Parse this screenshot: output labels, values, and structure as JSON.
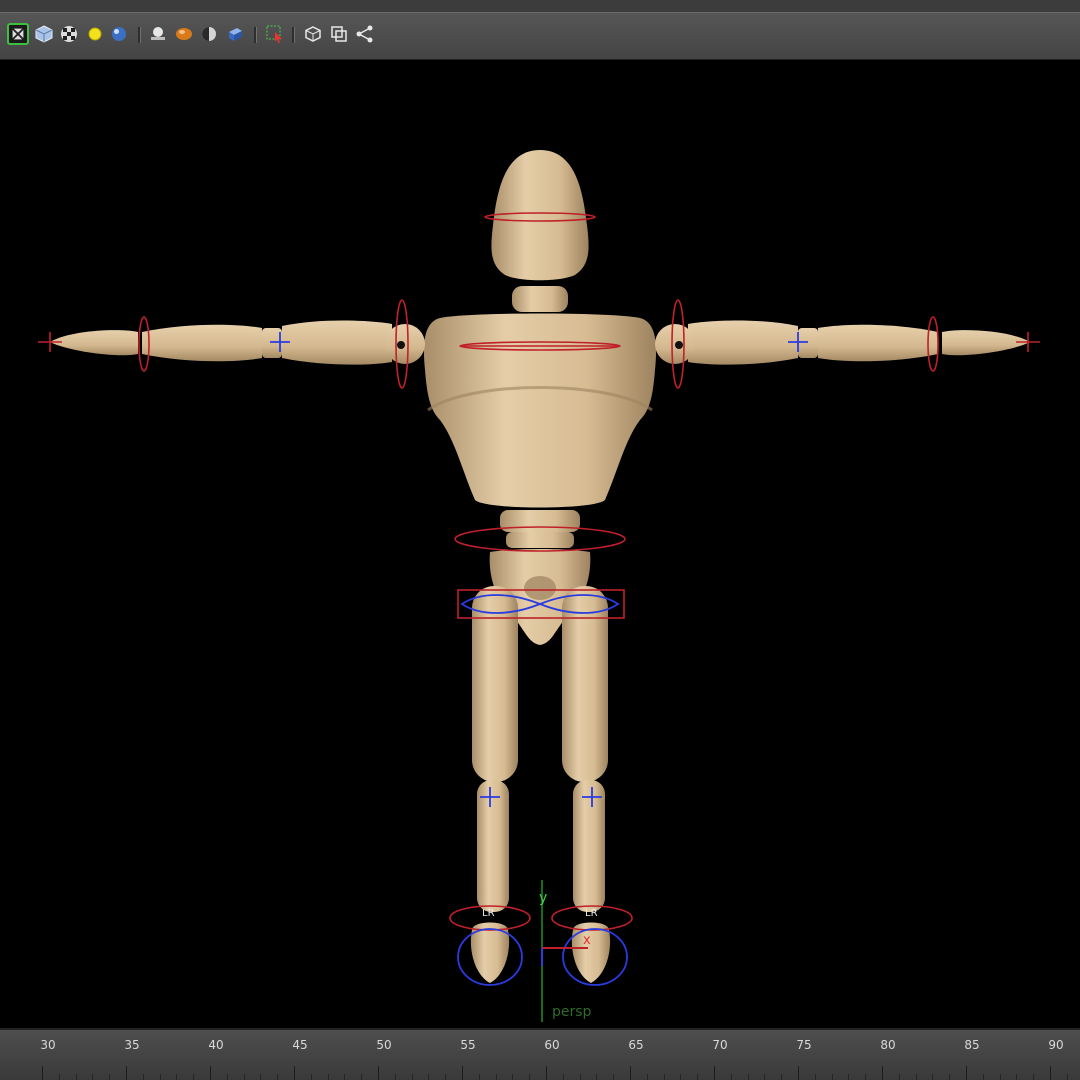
{
  "toolbar": {
    "icons": [
      "isolate-select-icon",
      "wireframe-cube-icon",
      "checker-texture-icon",
      "light-bulb-icon",
      "shaded-sphere-icon",
      "xray-joint-icon",
      "shadow-ball-icon",
      "half-sphere-icon",
      "blue-cube-icon",
      "select-camera-icon",
      "bounding-box-icon",
      "frame-all-icon",
      "share-graph-icon"
    ]
  },
  "viewport": {
    "camera_label": "persp",
    "axis_y_label": "y",
    "axis_x_label": "x",
    "foot_left_label": "LR",
    "foot_right_label": "LR",
    "background_color": "#000000",
    "skin_color": "#d9bf99",
    "control_color": "#c0202a",
    "joint_color": "#2a3be0"
  },
  "timeline": {
    "ticks": [
      "30",
      "35",
      "40",
      "45",
      "50",
      "55",
      "60",
      "65",
      "70",
      "75",
      "80",
      "85",
      "90"
    ]
  }
}
